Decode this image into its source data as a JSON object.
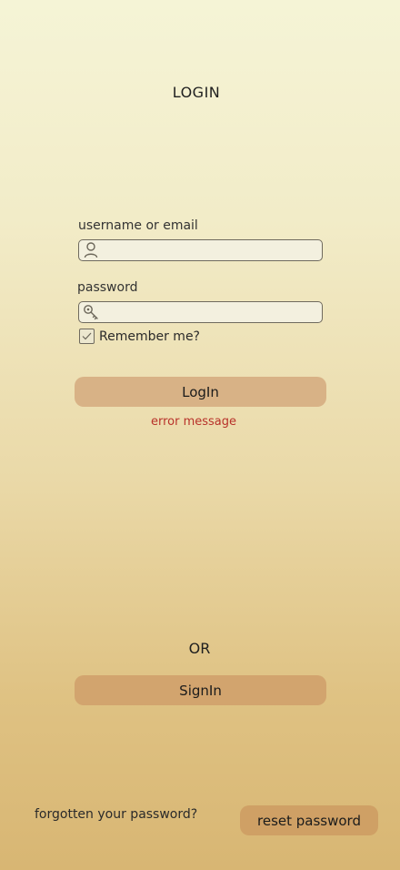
{
  "header": {
    "title": "LOGIN"
  },
  "form": {
    "username": {
      "label": "username or email",
      "value": "",
      "icon": "user-icon"
    },
    "password": {
      "label": "password",
      "value": "",
      "icon": "key-icon"
    },
    "remember": {
      "label": "Remember me?",
      "checked": true
    },
    "login_label": "LogIn",
    "error_message": "error message"
  },
  "alternate": {
    "or_label": "OR",
    "signin_label": "SignIn"
  },
  "footer": {
    "forgot_text": "forgotten your password?",
    "reset_label": "reset password"
  },
  "colors": {
    "background_top": "#f5f4d6",
    "background_bottom": "#d8b673",
    "login_button": "#d8b286",
    "signin_button": "#d2a46e",
    "reset_button": "#cfa065",
    "error": "#b8322a"
  }
}
